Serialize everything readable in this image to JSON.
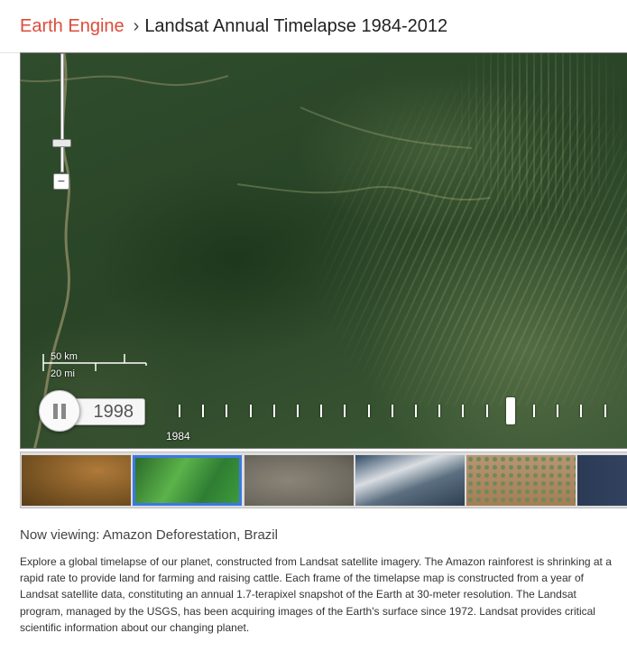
{
  "header": {
    "brand": "Earth Engine",
    "separator": "›",
    "title": "Landsat Annual Timelapse 1984-2012"
  },
  "map": {
    "scale": {
      "km_label": "50 km",
      "mi_label": "20 mi"
    },
    "zoom": {
      "minus_label": "−",
      "level_fraction": 0.28
    },
    "player": {
      "state": "playing",
      "play_pause_icon": "pause-icon",
      "current_year": "1998",
      "start_year_label": "1984",
      "timeline_years": [
        1984,
        1985,
        1986,
        1987,
        1988,
        1989,
        1990,
        1991,
        1992,
        1993,
        1994,
        1995,
        1996,
        1997,
        1998,
        1999,
        2000,
        2001,
        2002
      ],
      "current_index": 14
    }
  },
  "thumbnails": [
    {
      "name": "thumb-desert-canyon",
      "selected": false
    },
    {
      "name": "thumb-amazon",
      "selected": true
    },
    {
      "name": "thumb-urban",
      "selected": false
    },
    {
      "name": "thumb-glacier",
      "selected": false
    },
    {
      "name": "thumb-irrigation-circles",
      "selected": false
    },
    {
      "name": "thumb-coast",
      "selected": false
    }
  ],
  "info": {
    "now_viewing": "Now viewing: Amazon Deforestation, Brazil",
    "description": "Explore a global timelapse of our planet, constructed from Landsat satellite imagery. The Amazon rainforest is shrinking at a rapid rate to provide land for farming and raising cattle. Each frame of the timelapse map is constructed from a year of Landsat satellite data, constituting an annual 1.7-terapixel snapshot of the Earth at 30-meter resolution. The Landsat program, managed by the USGS, has been acquiring images of the Earth's surface since 1972. Landsat provides critical scientific information about our changing planet."
  },
  "colors": {
    "brand": "#dd4b39",
    "selection": "#3b78e7"
  }
}
